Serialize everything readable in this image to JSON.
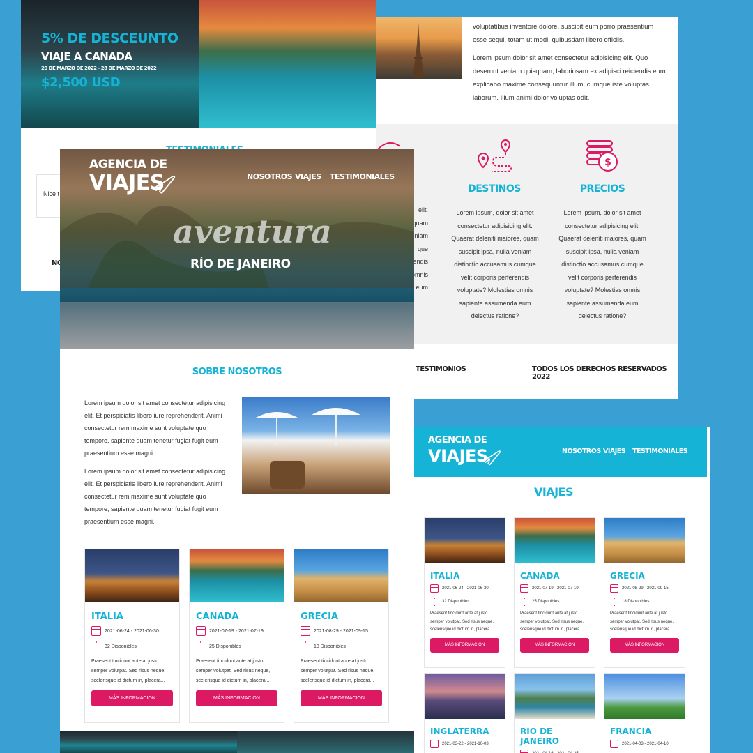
{
  "promo": {
    "discount": "5% DE DESCEUNTO",
    "trip": "VIAJE A CANADA",
    "dates": "20 DE MARZO DE 2022 - 28 DE MARZO DE 2022",
    "price": "$2,500 USD"
  },
  "testimonials_panel": {
    "title": "TESTIMONIALES",
    "quote_start": "Nice t",
    "footer_start": "NO"
  },
  "topright": {
    "para1": "voluptatibus inventore dolore, suscipit eum porro praesentium esse sequi, totam ut modi, quibusdam libero officiis.",
    "para2": "Lorem ipsum dolor sit amet consectetur adipisicing elit. Quo deserunt veniam quisquam, laboriosam ex adipisci reiciendis eum explicabo maxime consequuntur illum, cumque iste voluptas laborum. Illum animi dolor voluptas odit."
  },
  "features": {
    "left_fragments": [
      "elit.",
      "quam",
      "eniam",
      "que",
      "endis",
      "s omnis",
      "eum"
    ],
    "items": [
      {
        "title": "DESTINOS",
        "icon": "map-route-icon",
        "text": "Lorem ipsum, dolor sit amet consectetur adipisicing elit. Quaerat deleniti maiores, quam suscipit ipsa, nulla veniam distinctio accusamus cumque velit corporis perferendis voluptate? Molestias omnis sapiente assumenda eum delectus ratione?"
      },
      {
        "title": "PRECIOS",
        "icon": "coins-icon",
        "text": "Lorem ipsum, dolor sit amet consectetur adipisicing elit. Quaerat deleniti maiores, quam suscipit ipsa, nulla veniam distinctio accusamus cumque velit corporis perferendis voluptate? Molestias omnis sapiente assumenda eum delectus ratione?"
      }
    ]
  },
  "hero": {
    "logo_line1": "AGENCIA DE",
    "logo_line2": "VIAJES",
    "nav": [
      "NOSOTROS",
      "VIAJES",
      "TESTIMONIALES"
    ],
    "script": "aventura",
    "city": "RÍO DE JANEIRO"
  },
  "footer_strip": {
    "testimonios": "TESTIMONIOS",
    "rights": "TODOS LOS DERECHOS RESERVADOS 2022"
  },
  "about": {
    "title": "SOBRE NOSOTROS",
    "para1": "Lorem ipsum dolor sit amet consectetur adipisicing elit. Et perspiciatis libero iure reprehenderit. Animi consectetur rem maxime sunt voluptate quo tempore, sapiente quam tenetur fugiat fugit eum praesentium esse magni.",
    "para2": "Lorem ipsum dolor sit amet consectetur adipisicing elit. Et perspiciatis libero iure reprehenderit. Animi consectetur rem maxime sunt voluptate quo tempore, sapiente quam tenetur fugiat fugit eum praesentium esse magni."
  },
  "cards_left": [
    {
      "name": "ITALIA",
      "dates": "2021-06-24 - 2021-06-30",
      "avail": "32 Disponibles",
      "desc": "Praesent tincidunt ante at justo semper volutpat. Sed risus neque, scelerisque id dictum in, placera...",
      "btn": "MÁS INFORMACION",
      "photo": "colosseum"
    },
    {
      "name": "CANADA",
      "dates": "2021-07-19 - 2021-07-19",
      "avail": "25 Disponibles",
      "desc": "Praesent tincidunt ante at justo semper volutpat. Sed risus neque, scelerisque id dictum in, placera...",
      "btn": "MÁS INFORMACION",
      "photo": "lake"
    },
    {
      "name": "GRECIA",
      "dates": "2021-08-29 - 2021-09-15",
      "avail": "18 Disponibles",
      "desc": "Praesent tincidunt ante at justo semper volutpat. Sed risus neque, scelerisque id dictum in, placera...",
      "btn": "MÁS INFORMACION",
      "photo": "greece"
    }
  ],
  "viajes_page": {
    "logo_line1": "AGENCIA DE",
    "logo_line2": "VIAJES",
    "nav": [
      "NOSOTROS",
      "VIAJES",
      "TESTIMONIALES"
    ],
    "title": "VIAJES",
    "cards": [
      {
        "name": "ITALIA",
        "dates": "2021-06-24 - 2021-06-30",
        "avail": "32 Disponibles",
        "desc": "Praesent tincidunt ante at justo semper volutpat. Sed risus neque, scelerisque id dictum in, placera...",
        "btn": "MÁS INFORMACION",
        "photo": "colosseum"
      },
      {
        "name": "CANADA",
        "dates": "2021-07-19 - 2021-07-19",
        "avail": "25 Disponibles",
        "desc": "Praesent tincidunt ante at justo semper volutpat. Sed risus neque, scelerisque id dictum in, placera...",
        "btn": "MÁS INFORMACION",
        "photo": "lake"
      },
      {
        "name": "GRECIA",
        "dates": "2021-08-29 - 2021-09-15",
        "avail": "18 Disponibles",
        "desc": "Praesent tincidunt ante at justo semper volutpat. Sed risus neque, scelerisque id dictum in, placera...",
        "btn": "MÁS INFORMACION",
        "photo": "greece"
      },
      {
        "name": "INGLATERRA",
        "dates": "2021-03-22 - 2021-10-03",
        "photo": "london"
      },
      {
        "name": "RIO DE JANEIRO",
        "dates": "2021-04-16 - 2021-04-25",
        "photo": "rio"
      },
      {
        "name": "FRANCIA",
        "dates": "2021-04-03 - 2021-04-10",
        "photo": "france"
      }
    ]
  }
}
